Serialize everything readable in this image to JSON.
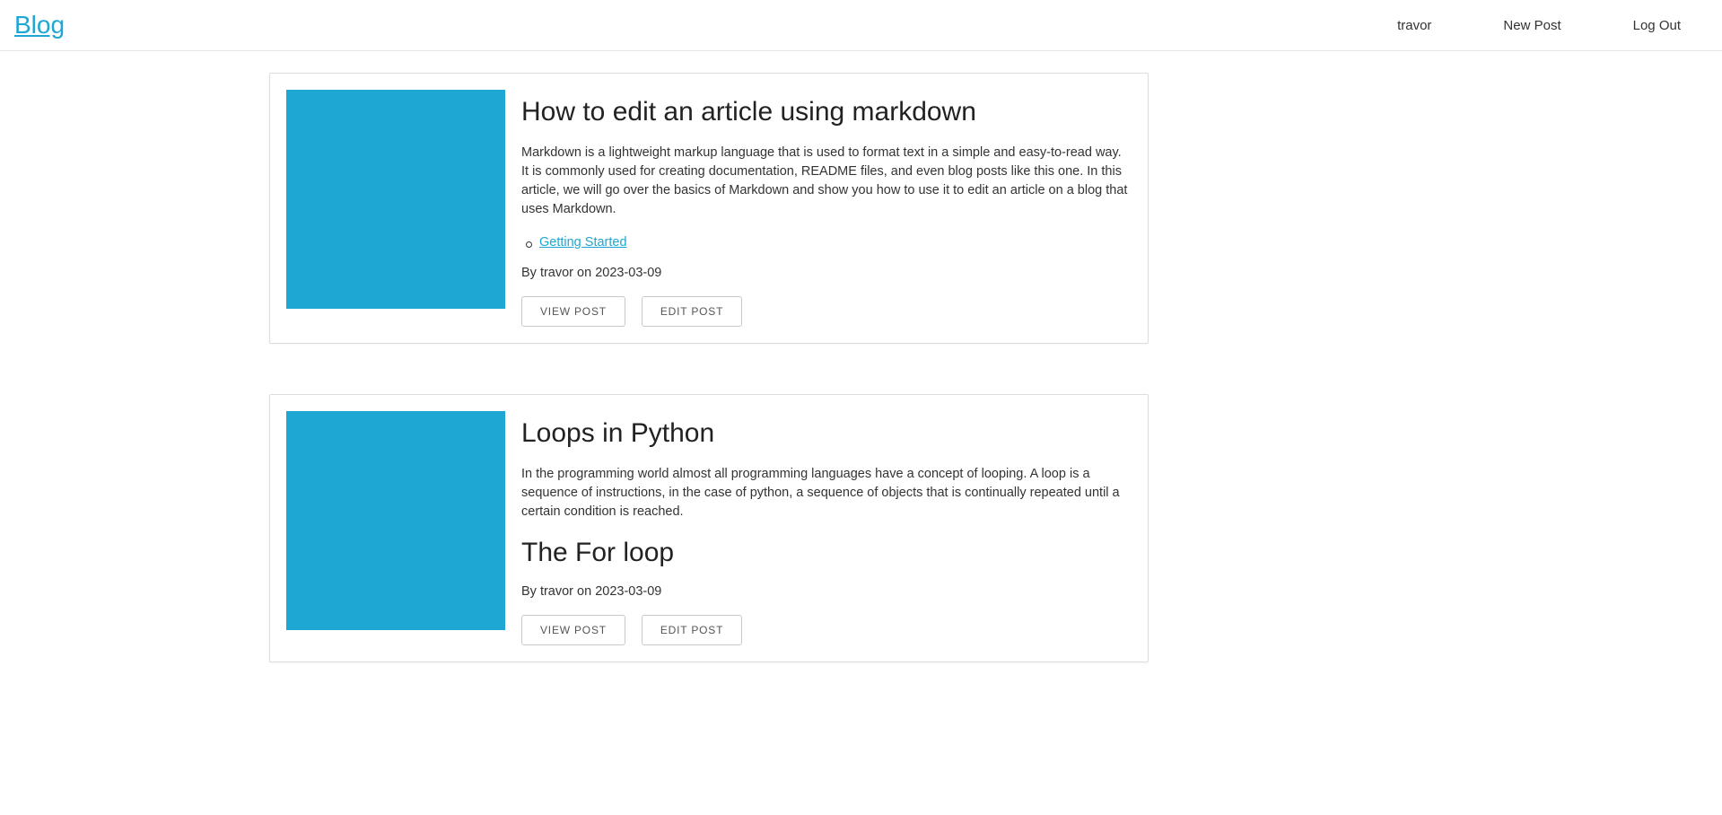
{
  "header": {
    "brand": "Blog",
    "nav": {
      "user": "travor",
      "new_post": "New Post",
      "log_out": "Log Out"
    }
  },
  "posts": [
    {
      "title": "How to edit an article using markdown",
      "excerpt": "Markdown is a lightweight markup language that is used to format text in a simple and easy-to-read way. It is commonly used for creating documentation, README files, and even blog posts like this one. In this article, we will go over the basics of Markdown and show you how to use it to edit an article on a blog that uses Markdown.",
      "links": [
        {
          "label": "Getting Started"
        }
      ],
      "byline": "By travor on 2023-03-09",
      "view_label": "VIEW POST",
      "edit_label": "EDIT POST"
    },
    {
      "title": "Loops in Python",
      "excerpt": "In the programming world almost all programming languages have a concept of looping. A loop is a sequence of instructions, in the case of python, a sequence of objects that is continually repeated until a certain condition is reached.",
      "subheading": "The For loop",
      "byline": "By travor on 2023-03-09",
      "view_label": "VIEW POST",
      "edit_label": "EDIT POST"
    }
  ]
}
